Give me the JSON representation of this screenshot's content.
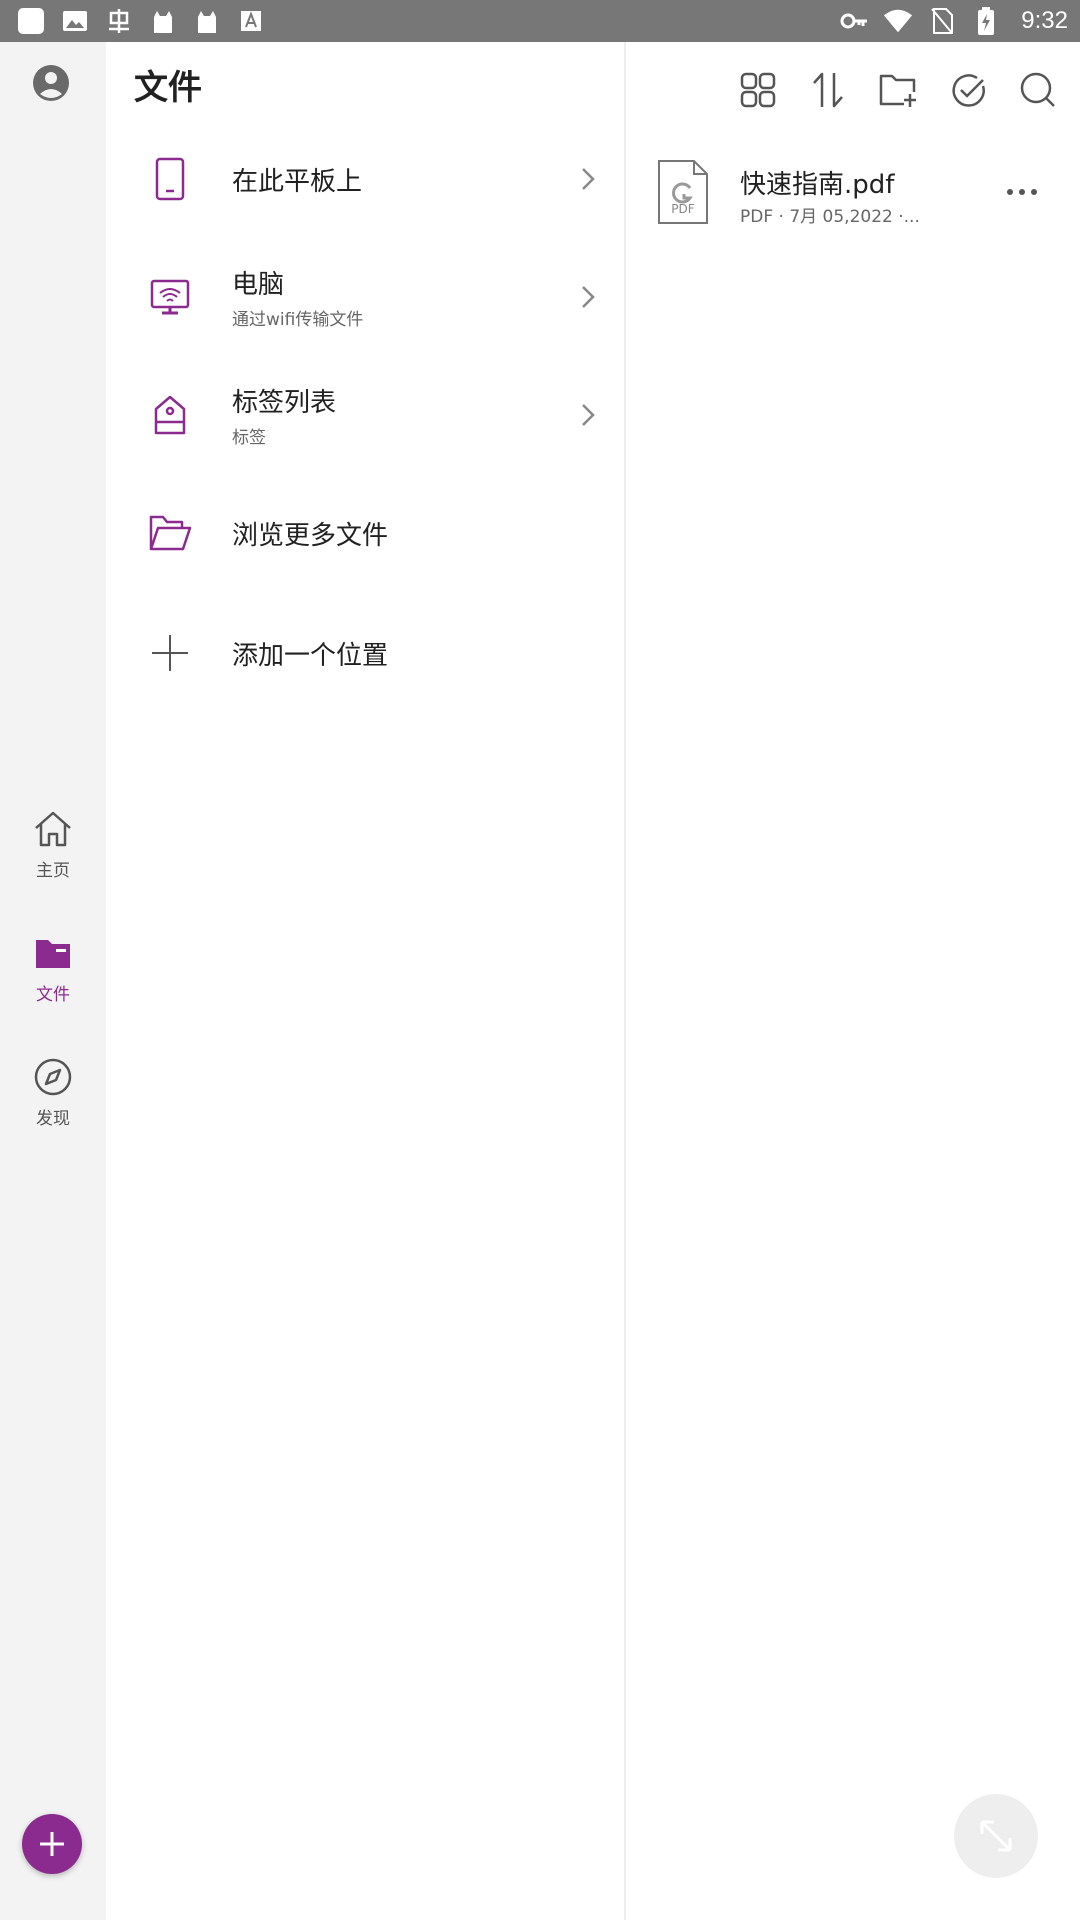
{
  "status_bar": {
    "time": "9:32",
    "left_icons": [
      "app-square-icon",
      "image-icon",
      "chinese-char-icon",
      "cat-icon",
      "cat-icon",
      "font-icon"
    ],
    "right_icons": [
      "key-icon",
      "wifi-icon",
      "no-sim-icon",
      "battery-charging-icon"
    ]
  },
  "nav": {
    "items": [
      {
        "label": "主页",
        "icon": "home-icon"
      },
      {
        "label": "文件",
        "icon": "folder-icon",
        "active": true
      },
      {
        "label": "发现",
        "icon": "compass-icon"
      }
    ],
    "fab_icon": "plus-icon"
  },
  "files_panel": {
    "title": "文件",
    "locations": [
      {
        "title": "在此平板上",
        "subtitle": "",
        "icon": "tablet-icon",
        "chevron": true
      },
      {
        "title": "电脑",
        "subtitle": "通过wifi传输文件",
        "icon": "monitor-wifi-icon",
        "chevron": true
      },
      {
        "title": "标签列表",
        "subtitle": "标签",
        "icon": "tag-icon",
        "chevron": true
      },
      {
        "title": "浏览更多文件",
        "subtitle": "",
        "icon": "folder-open-icon",
        "chevron": false
      },
      {
        "title": "添加一个位置",
        "subtitle": "",
        "icon": "plus-icon",
        "chevron": false
      }
    ]
  },
  "toolbar": {
    "icons": [
      "grid-view-icon",
      "sort-icon",
      "new-folder-icon",
      "select-check-icon",
      "search-icon"
    ]
  },
  "file_list": {
    "items": [
      {
        "name": "快速指南.pdf",
        "meta": "PDF · 7月 05,2022 ·...",
        "icon_label": "PDF"
      }
    ]
  },
  "colors": {
    "accent": "#8b2a8f",
    "status_bar": "#777777",
    "rail_bg": "#f3f3f3"
  }
}
